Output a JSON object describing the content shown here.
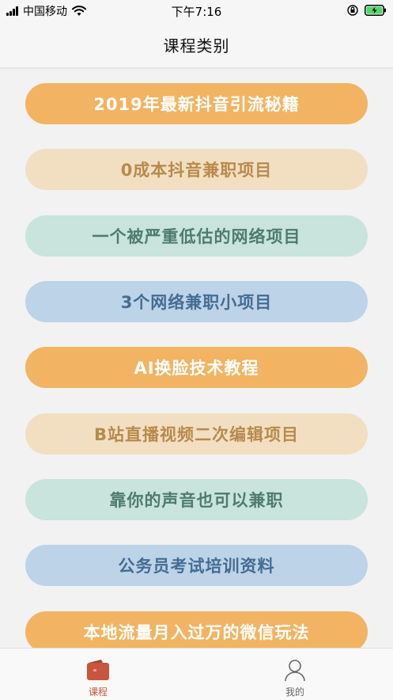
{
  "status_bar": {
    "carrier": "中国移动",
    "time": "下午7:16"
  },
  "header": {
    "title": "课程类别"
  },
  "courses": [
    {
      "label": "2019年最新抖音引流秘籍",
      "bg": "#f2b462",
      "fg": "#ffffff"
    },
    {
      "label": "0成本抖音兼职项目",
      "bg": "#f2dfc2",
      "fg": "#b78a4c"
    },
    {
      "label": "一个被严重低估的网络项目",
      "bg": "#c8e4dc",
      "fg": "#4f7b6f"
    },
    {
      "label": "3个网络兼职小项目",
      "bg": "#bcd3e8",
      "fg": "#456c92"
    },
    {
      "label": "AI换脸技术教程",
      "bg": "#f2b462",
      "fg": "#ffffff"
    },
    {
      "label": "B站直播视频二次编辑项目",
      "bg": "#f2dfc2",
      "fg": "#b78a4c"
    },
    {
      "label": "靠你的声音也可以兼职",
      "bg": "#c8e4dc",
      "fg": "#4f7b6f"
    },
    {
      "label": "公务员考试培训资料",
      "bg": "#bcd3e8",
      "fg": "#456c92"
    },
    {
      "label": "本地流量月入过万的微信玩法",
      "bg": "#f2b462",
      "fg": "#ffffff"
    }
  ],
  "tab_bar": {
    "tabs": [
      {
        "label": "课程",
        "icon": "course-icon",
        "active": true
      },
      {
        "label": "我的",
        "icon": "user-icon",
        "active": false
      }
    ]
  },
  "colors": {
    "accent": "#c8553d",
    "background": "#f2f2f2"
  }
}
